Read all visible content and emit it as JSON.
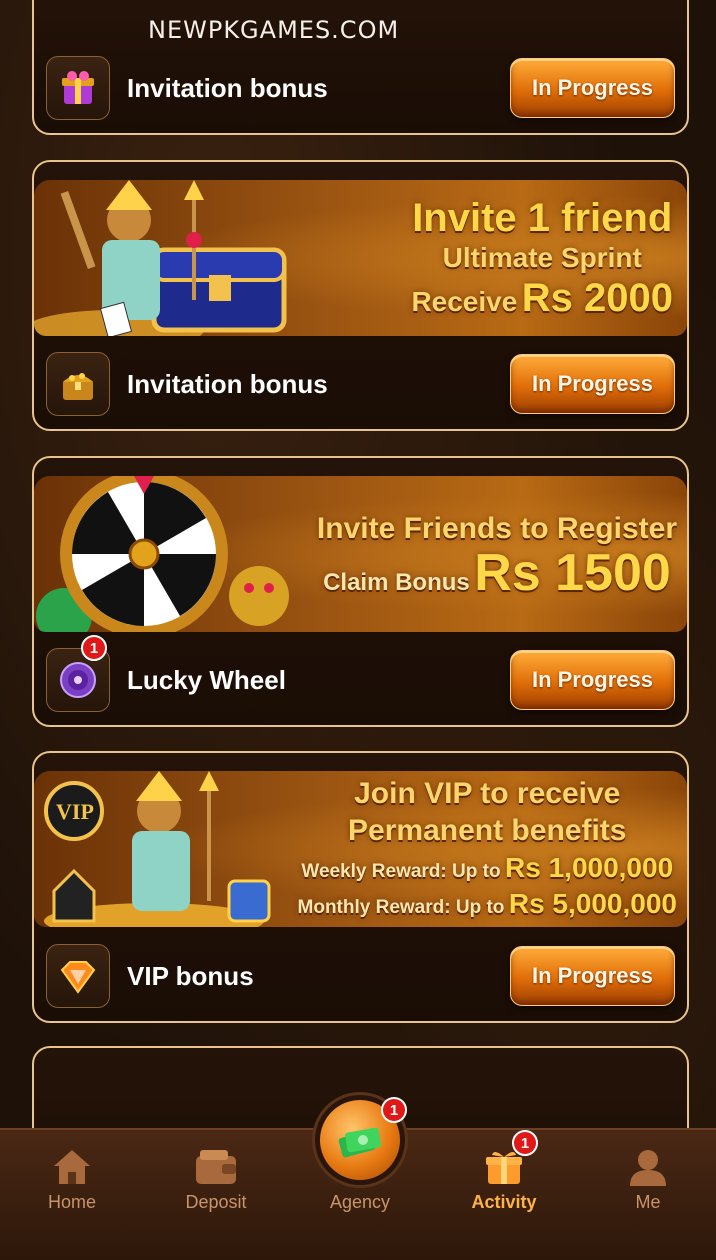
{
  "watermark": "NEWPKGAMES.COM",
  "colors": {
    "accent": "#e06d08",
    "card_border": "#e9c48a",
    "badge": "#e01818",
    "nav_active": "#ffb347"
  },
  "cards": [
    {
      "label": "Invitation bonus",
      "icon": "gift-box-icon",
      "button": "In Progress"
    },
    {
      "banner": {
        "line1": "Invite 1 friend",
        "line2": "Ultimate Sprint",
        "line3_prefix": "Receive",
        "line3_amount": "Rs 2000"
      },
      "label": "Invitation bonus",
      "icon": "treasure-chest-icon",
      "button": "In Progress"
    },
    {
      "banner": {
        "line1": "Invite Friends to Register",
        "line2_prefix": "Claim Bonus",
        "line2_amount": "Rs 1500"
      },
      "label": "Lucky Wheel",
      "icon": "wheel-icon",
      "badge": "1",
      "button": "In Progress"
    },
    {
      "banner": {
        "line1": "Join VIP to receive",
        "line2": "Permanent benefits",
        "line3_prefix": "Weekly Reward: Up to",
        "line3_amount": "Rs 1,000,000",
        "line4_prefix": "Monthly Reward: Up to",
        "line4_amount": "Rs 5,000,000"
      },
      "label": "VIP bonus",
      "icon": "vip-diamond-icon",
      "button": "In Progress"
    }
  ],
  "nav": {
    "home": "Home",
    "deposit": "Deposit",
    "agency": "Agency",
    "agency_badge": "1",
    "activity": "Activity",
    "activity_badge": "1",
    "me": "Me"
  }
}
